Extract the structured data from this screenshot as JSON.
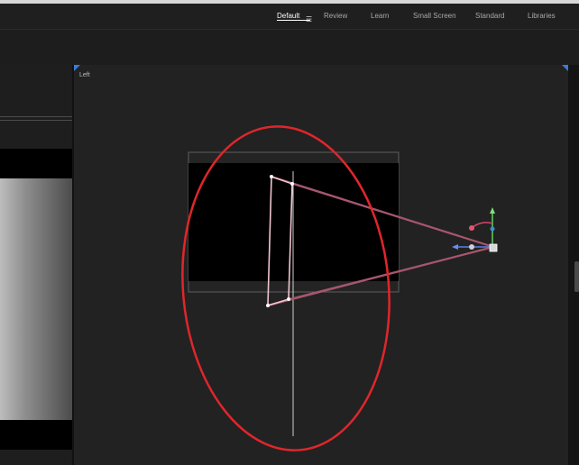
{
  "workspace_tabs": [
    "Default",
    "Review",
    "Learn",
    "Small Screen",
    "Standard",
    "Libraries"
  ],
  "active_tab": "Default",
  "viewport": {
    "label": "Left"
  },
  "colors": {
    "frustum": "#a6566e",
    "annotation": "#e0262b",
    "corner_marker": "#3b7bd6",
    "gizmo_y": "#5fd25f",
    "gizmo_x": "#5a7fe6",
    "gizmo_rot": "#d6456a"
  }
}
